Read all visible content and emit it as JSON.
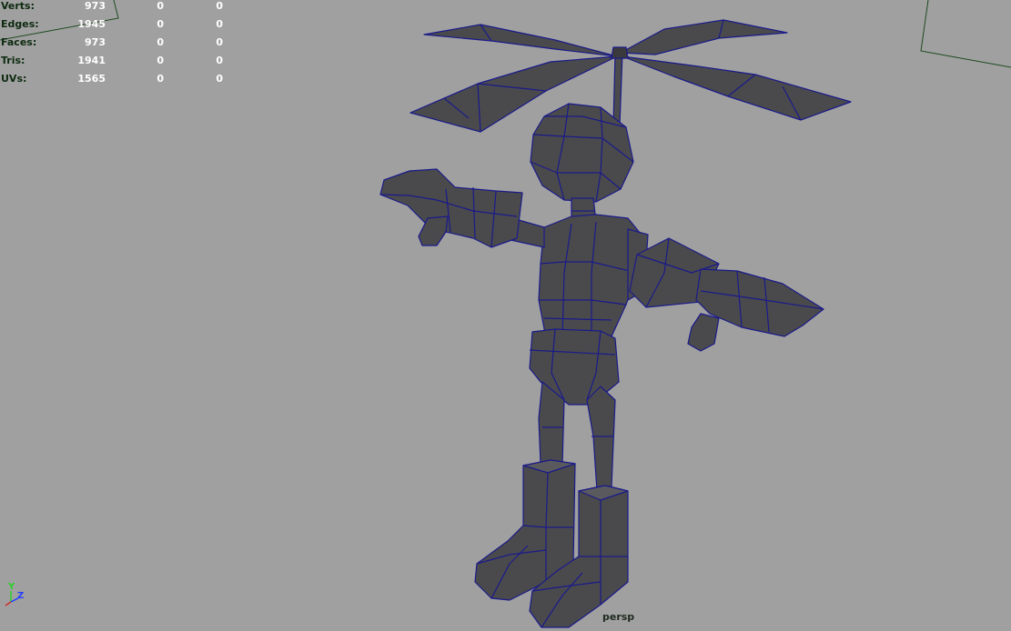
{
  "hud": {
    "rows": [
      {
        "label": "Verts:",
        "v1": "973",
        "v2": "0",
        "v3": "0"
      },
      {
        "label": "Edges:",
        "v1": "1945",
        "v2": "0",
        "v3": "0"
      },
      {
        "label": "Faces:",
        "v1": "973",
        "v2": "0",
        "v3": "0"
      },
      {
        "label": "Tris:",
        "v1": "1941",
        "v2": "0",
        "v3": "0"
      },
      {
        "label": "UVs:",
        "v1": "1565",
        "v2": "0",
        "v3": "0"
      }
    ]
  },
  "camera": "persp",
  "axes": {
    "y": "Y",
    "z": "Z"
  },
  "colors": {
    "background": "#a0a0a0",
    "mesh_fill": "#4a4a4d",
    "mesh_dark": "#3a3a3d",
    "wire": "#1a1a8a",
    "grid_line": "#1e4a1e"
  }
}
